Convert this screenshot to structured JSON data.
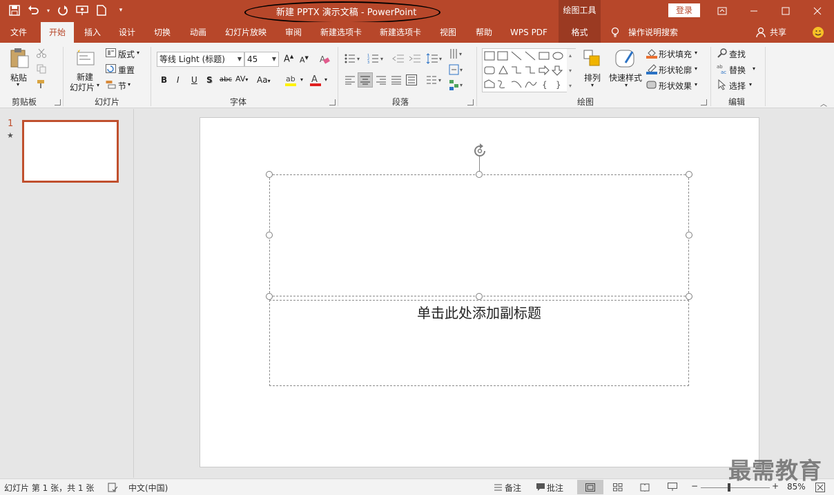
{
  "titlebar": {
    "title": "新建 PPTX 演示文稿  -  PowerPoint",
    "context_tool": "绘图工具",
    "login": "登录"
  },
  "tabs": [
    "文件",
    "开始",
    "插入",
    "设计",
    "切换",
    "动画",
    "幻灯片放映",
    "审阅",
    "新建选项卡",
    "新建选项卡",
    "视图",
    "帮助",
    "WPS PDF",
    "格式"
  ],
  "tell_me": "操作说明搜索",
  "share": "共享",
  "ribbon": {
    "clipboard": {
      "paste": "粘贴",
      "label": "剪贴板"
    },
    "slides": {
      "new_slide": "新建",
      "new_slide2": "幻灯片",
      "layout": "版式",
      "reset": "重置",
      "section": "节",
      "label": "幻灯片"
    },
    "font": {
      "font_name": "等线 Light (标题)",
      "font_size": "45",
      "label": "字体"
    },
    "paragraph": {
      "label": "段落"
    },
    "drawing": {
      "arrange": "排列",
      "quick_styles": "快速样式",
      "shape_fill": "形状填充",
      "shape_outline": "形状轮廓",
      "shape_effects": "形状效果",
      "label": "绘图"
    },
    "editing": {
      "find": "查找",
      "replace": "替换",
      "select": "选择",
      "label": "编辑"
    }
  },
  "thumbs": {
    "number": "1",
    "star": "★"
  },
  "slide": {
    "subtitle_placeholder": "单击此处添加副标题"
  },
  "status": {
    "slide_info": "幻灯片 第 1 张，共 1 张",
    "language": "中文(中国)",
    "notes": "备注",
    "comments": "批注",
    "zoom": "85%"
  },
  "watermark": "最需教育",
  "colors": {
    "accent": "#b7472a",
    "context_tab": "#9b3a22",
    "thumb_border": "#c0502e"
  }
}
